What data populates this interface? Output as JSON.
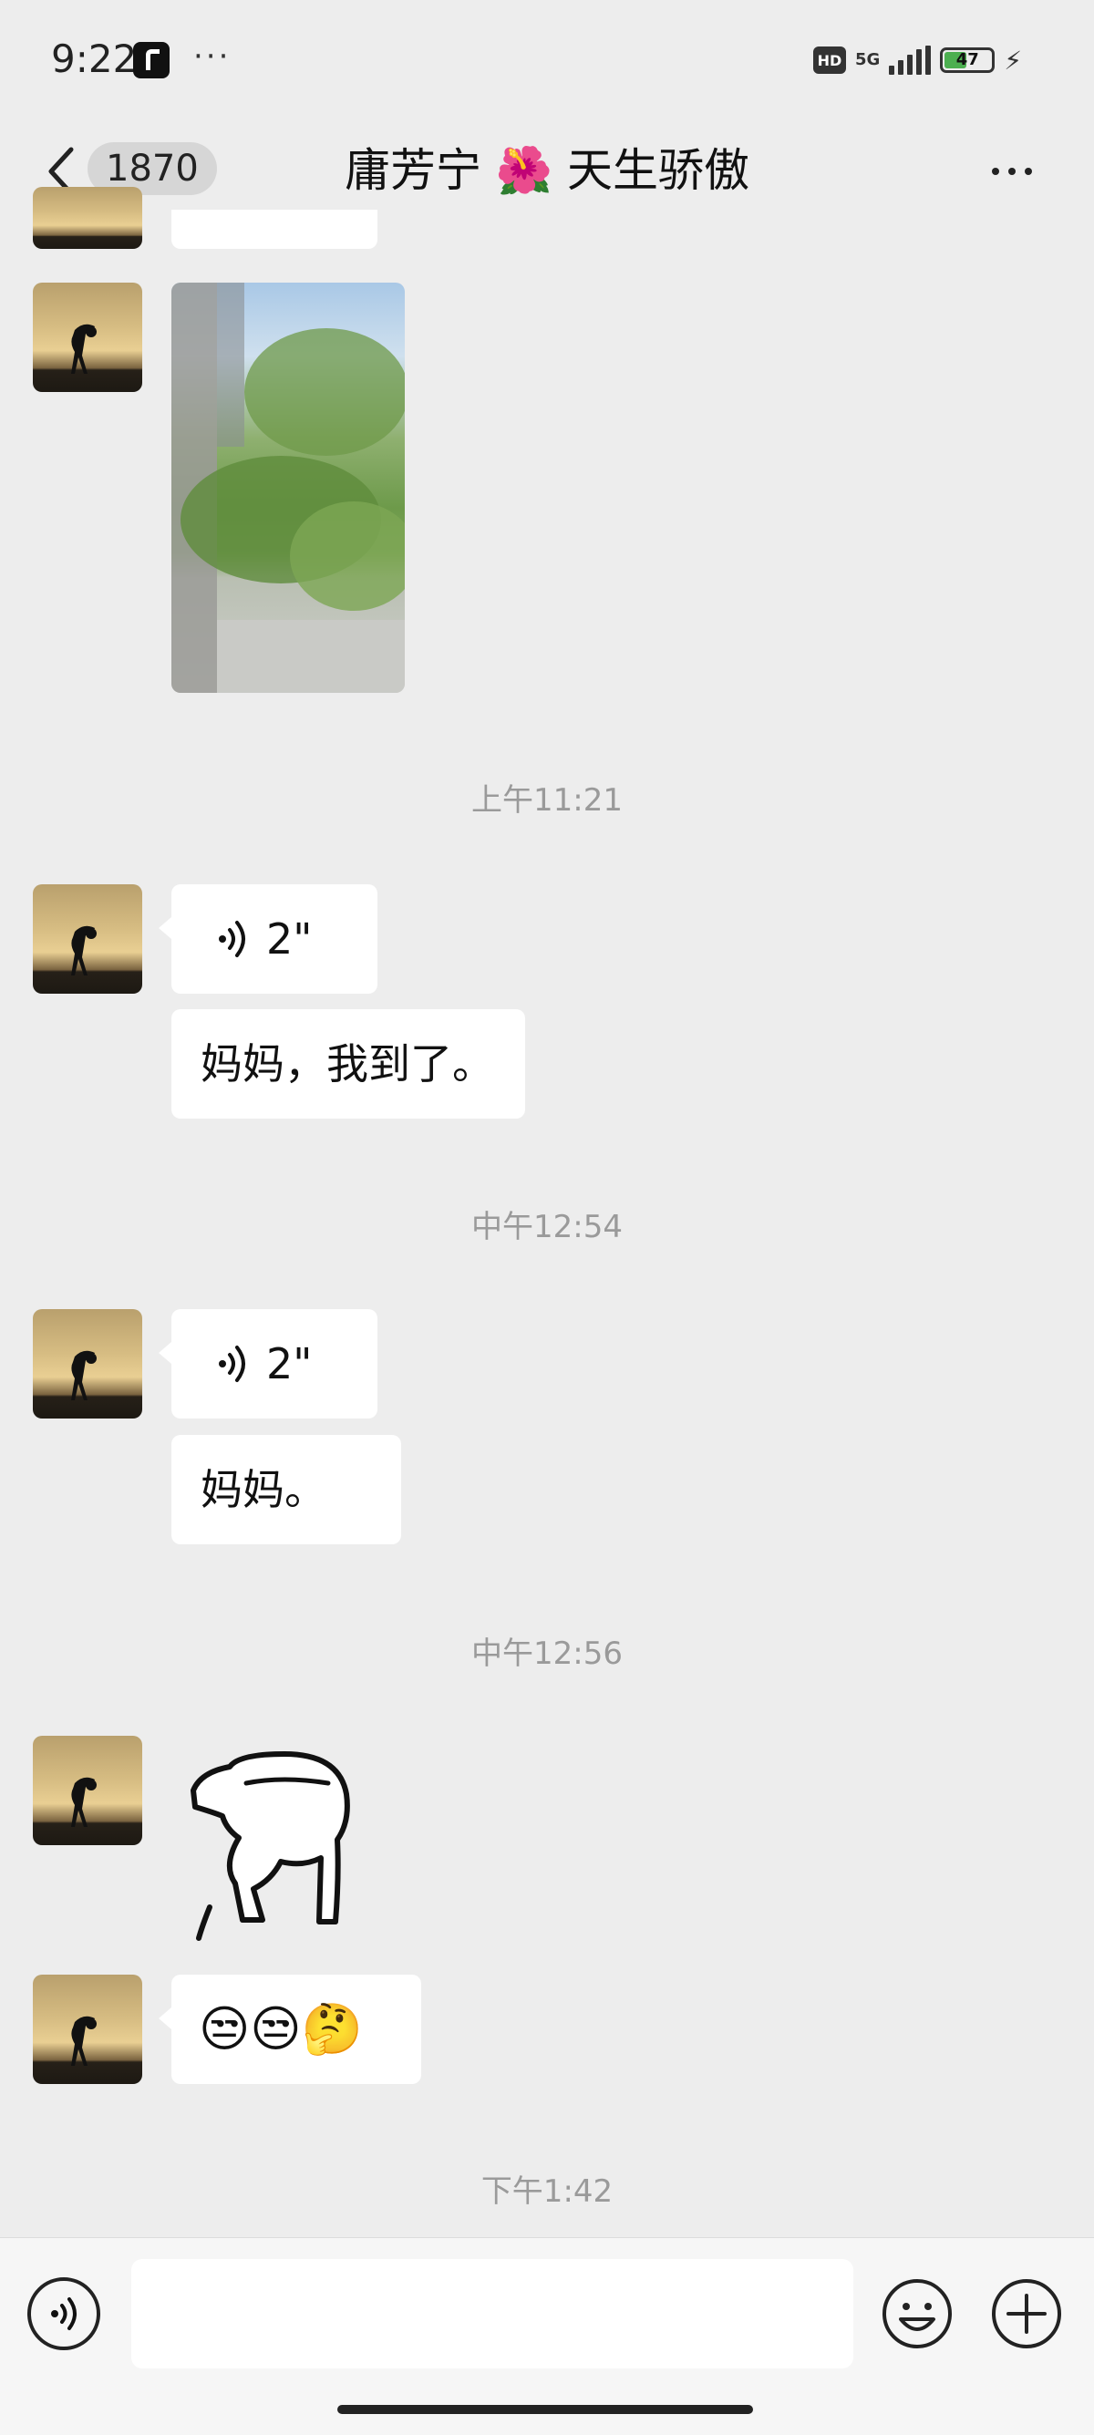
{
  "status_bar": {
    "time": "9:22",
    "more": "···",
    "hd": "HD",
    "network": "5G",
    "battery": "47",
    "battery_level": 0.47
  },
  "header": {
    "unread_count": "1870",
    "title": "庸芳宁 🌺 天生骄傲"
  },
  "messages": {
    "ts1": "上午11:21",
    "voice1_duration": "2\"",
    "text1": "妈妈，我到了。",
    "ts2": "中午12:54",
    "voice2_duration": "2\"",
    "text2": "妈妈。",
    "ts3": "中午12:56",
    "emoji_text": "😒😒🤔",
    "ts4": "下午1:42"
  },
  "input": {
    "placeholder": ""
  },
  "colors": {
    "background": "#ededed",
    "bubble": "#ffffff",
    "timestamp": "#9a9a9a"
  }
}
